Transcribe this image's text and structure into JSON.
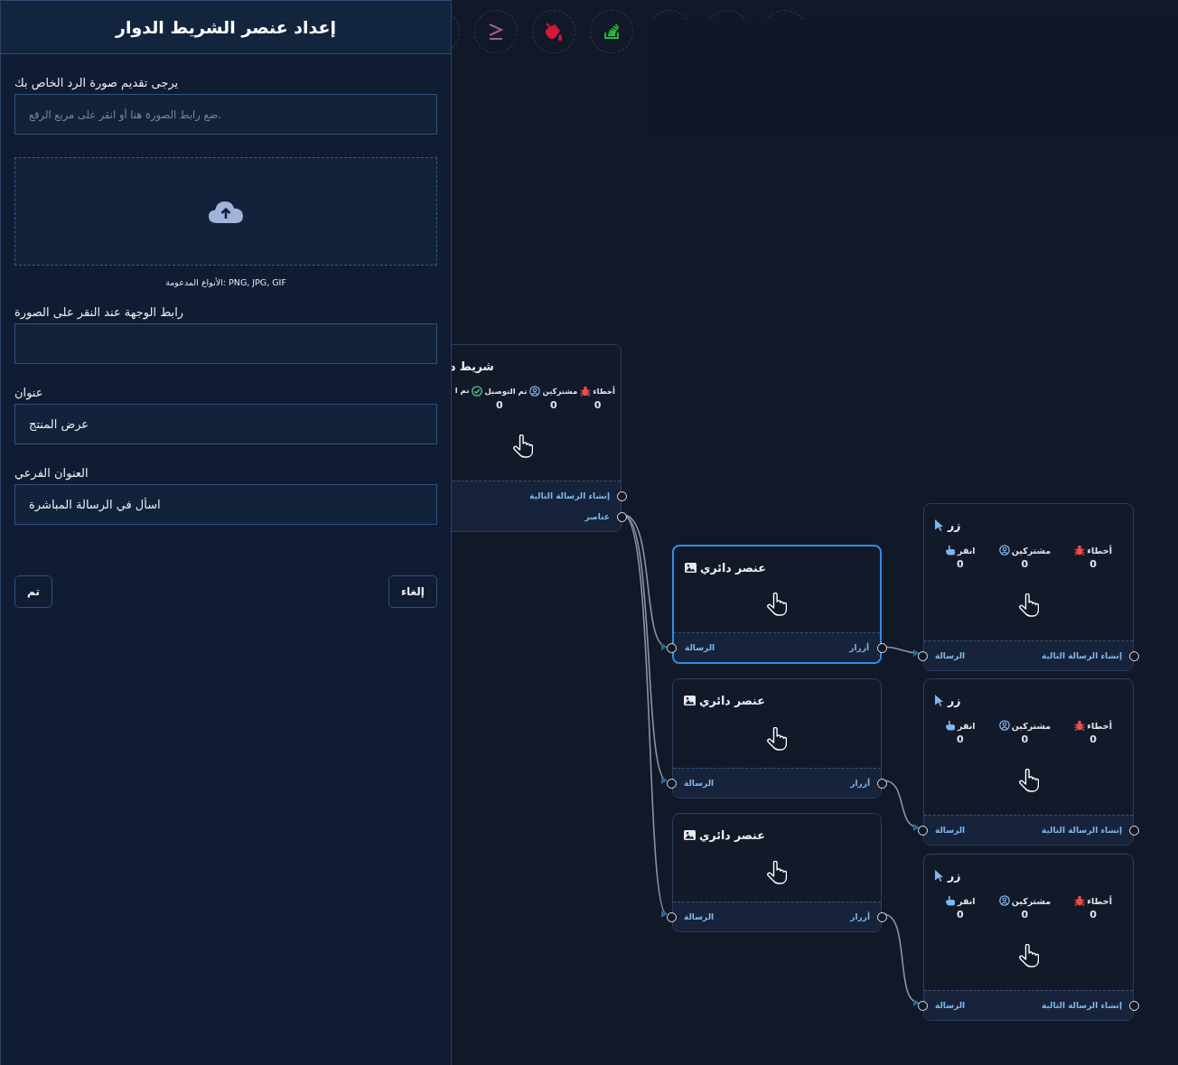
{
  "panel": {
    "title": "إعداد عنصر الشريط الدوار",
    "image_field": {
      "label": "يرجى تقديم صورة الرد الخاص بك",
      "placeholder": "ضع رابط الصورة هنا أو انقر على مربع الرفع."
    },
    "upload": {
      "hint": "الأنواع المدعومة: PNG, JPG, GIF"
    },
    "fields": [
      {
        "label": "رابط الوجهة عند النقر على الصورة"
      },
      {
        "label": "عنوان",
        "value": "عرض المنتج"
      },
      {
        "label": "العنوان الفرعي",
        "value": "اسأل في الرسالة المباشرة"
      }
    ],
    "buttons": {
      "done": "تم",
      "cancel": "إلغاء"
    }
  },
  "toolbar": [
    {
      "kind": "empty"
    },
    {
      "kind": "greater-equal"
    },
    {
      "kind": "paint-bucket"
    },
    {
      "kind": "stack"
    },
    {
      "kind": "empty"
    },
    {
      "kind": "empty"
    },
    {
      "kind": "empty"
    }
  ],
  "nodes": [
    {
      "kind": "carousel",
      "title": "شريط د",
      "selected": false,
      "stats": [
        {
          "kind": "errors",
          "label": "أخطاء",
          "value": "0"
        },
        {
          "kind": "subscribers",
          "label": "مشتركين",
          "value": "0"
        },
        {
          "kind": "delivered",
          "label": "تم التوصيل",
          "value": "0"
        },
        {
          "kind": "other",
          "label": "تم ا"
        }
      ],
      "outputs": [
        "إنشاء الرسالة التالية",
        "عناصر"
      ]
    },
    {
      "kind": "carousel_item",
      "title": "عنصر دائري",
      "selected": true,
      "inputs": [
        "الرسالة"
      ],
      "outputs": [
        "أزرار"
      ]
    },
    {
      "kind": "carousel_item",
      "title": "عنصر دائري",
      "selected": false,
      "inputs": [
        "الرسالة"
      ],
      "outputs": [
        "أزرار"
      ]
    },
    {
      "kind": "carousel_item",
      "title": "عنصر دائري",
      "selected": false,
      "inputs": [
        "الرسالة"
      ],
      "outputs": [
        "أزرار"
      ]
    },
    {
      "kind": "button",
      "title": "زر",
      "selected": false,
      "stats": [
        {
          "kind": "errors",
          "label": "أخطاء",
          "value": "0"
        },
        {
          "kind": "subscribers",
          "label": "مشتركين",
          "value": "0"
        },
        {
          "kind": "clicks",
          "label": "انقر",
          "value": "0"
        }
      ],
      "inputs": [
        "الرسالة"
      ],
      "outputs": [
        "إنشاء الرسالة التالية"
      ]
    },
    {
      "kind": "button",
      "title": "زر",
      "selected": false,
      "stats": [
        {
          "kind": "errors",
          "label": "أخطاء",
          "value": "0"
        },
        {
          "kind": "subscribers",
          "label": "مشتركين",
          "value": "0"
        },
        {
          "kind": "clicks",
          "label": "انقر",
          "value": "0"
        }
      ],
      "inputs": [
        "الرسالة"
      ],
      "outputs": [
        "إنشاء الرسالة التالية"
      ]
    },
    {
      "kind": "button",
      "title": "زر",
      "selected": false,
      "stats": [
        {
          "kind": "errors",
          "label": "أخطاء",
          "value": "0"
        },
        {
          "kind": "subscribers",
          "label": "مشتركين",
          "value": "0"
        },
        {
          "kind": "clicks",
          "label": "انقر",
          "value": "0"
        }
      ],
      "inputs": [
        "الرسالة"
      ],
      "outputs": [
        "إنشاء الرسالة التالية"
      ]
    }
  ]
}
